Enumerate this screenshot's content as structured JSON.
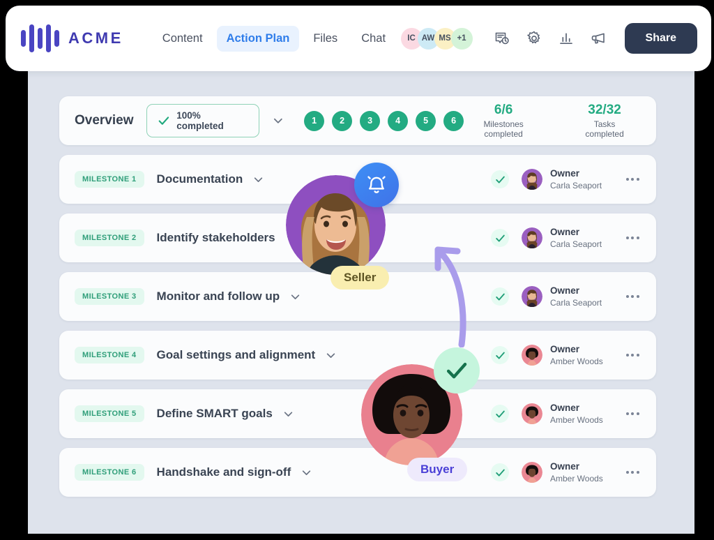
{
  "brand": {
    "name": "ACME",
    "logo_icon": "sound-bars-logo",
    "logo_color": "#4a45c2"
  },
  "nav": {
    "items": [
      {
        "label": "Content",
        "active": false
      },
      {
        "label": "Action Plan",
        "active": true
      },
      {
        "label": "Files",
        "active": false
      },
      {
        "label": "Chat",
        "active": false
      }
    ],
    "active_color": "#2f7dea"
  },
  "avatars": [
    {
      "initials": "IC",
      "color": "#fbd9e2"
    },
    {
      "initials": "AW",
      "color": "#cdeaf5"
    },
    {
      "initials": "MS",
      "color": "#fbf0c4"
    },
    {
      "initials": "+1",
      "color": "#d4f3d8"
    }
  ],
  "header_icons": [
    {
      "name": "activity-history-icon"
    },
    {
      "name": "gear-icon"
    },
    {
      "name": "analytics-bar-chart-icon"
    },
    {
      "name": "megaphone-icon"
    }
  ],
  "share": {
    "label": "Share",
    "bg": "#2e3a52"
  },
  "overview": {
    "title": "Overview",
    "completion_label": "100% completed",
    "completion_icon": "check-icon",
    "collapse_icon": "chevron-down-icon",
    "steps": [
      "1",
      "2",
      "3",
      "4",
      "5",
      "6"
    ],
    "step_color": "#23ab82",
    "stats": [
      {
        "value": "6/6",
        "label": "Milestones completed"
      },
      {
        "value": "32/32",
        "label": "Tasks completed"
      }
    ]
  },
  "milestones": [
    {
      "badge": "MILESTONE 1",
      "title": "Documentation",
      "check_icon": "check-icon",
      "owner_role": "Owner",
      "owner_name": "Carla Seaport",
      "owner_avatar": "carla-avatar",
      "menu_icon": "more-options-icon"
    },
    {
      "badge": "MILESTONE 2",
      "title": "Identify stakeholders",
      "check_icon": "check-icon",
      "owner_role": "Owner",
      "owner_name": "Carla Seaport",
      "owner_avatar": "carla-avatar",
      "menu_icon": "more-options-icon"
    },
    {
      "badge": "MILESTONE 3",
      "title": "Monitor and follow up",
      "check_icon": "check-icon",
      "owner_role": "Owner",
      "owner_name": "Carla Seaport",
      "owner_avatar": "carla-avatar",
      "menu_icon": "more-options-icon"
    },
    {
      "badge": "MILESTONE 4",
      "title": "Goal settings and alignment",
      "check_icon": "check-icon",
      "owner_role": "Owner",
      "owner_name": "Amber Woods",
      "owner_avatar": "amber-avatar",
      "menu_icon": "more-options-icon"
    },
    {
      "badge": "MILESTONE 5",
      "title": "Define SMART goals",
      "check_icon": "check-icon",
      "owner_role": "Owner",
      "owner_name": "Amber Woods",
      "owner_avatar": "amber-avatar",
      "menu_icon": "more-options-icon"
    },
    {
      "badge": "MILESTONE 6",
      "title": "Handshake and sign-off",
      "check_icon": "check-icon",
      "owner_role": "Owner",
      "owner_name": "Amber Woods",
      "owner_avatar": "amber-avatar",
      "menu_icon": "more-options-icon"
    }
  ],
  "overlays": {
    "seller": {
      "role_label": "Seller",
      "tag_bg": "#f9eeb0",
      "tag_text": "#5d5423",
      "badge_icon": "bell-notification-icon",
      "photo": "seller-photo"
    },
    "buyer": {
      "role_label": "Buyer",
      "tag_bg": "#eeeafc",
      "tag_text": "#4a3fd6",
      "badge_icon": "check-icon",
      "photo": "buyer-photo"
    },
    "arrow": {
      "name": "curved-arrow",
      "color": "#a99ceb"
    }
  }
}
